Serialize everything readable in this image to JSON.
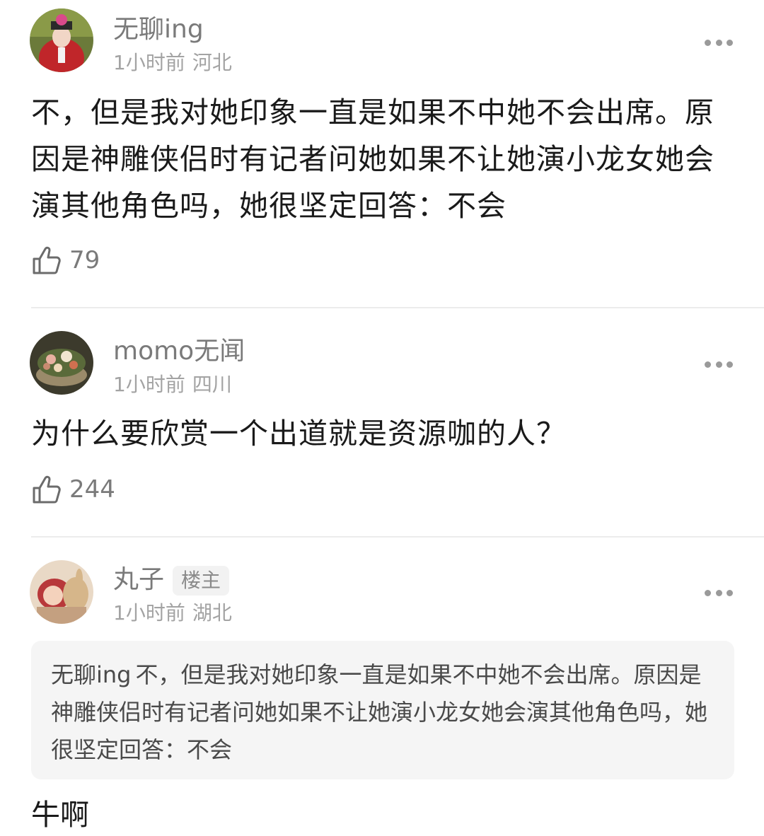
{
  "comments": [
    {
      "username": "无聊ing",
      "time": "1小时前",
      "location": "河北",
      "text": "不，但是我对她印象一直是如果不中她不会出席。原因是神雕侠侣时有记者问她如果不让她演小龙女她会演其他角色吗，她很坚定回答：不会",
      "likes": "79"
    },
    {
      "username": "momo无闻",
      "time": "1小时前",
      "location": "四川",
      "text": "为什么要欣赏一个出道就是资源咖的人？",
      "likes": "244"
    },
    {
      "username": "丸子",
      "badge": "楼主",
      "time": "1小时前",
      "location": "湖北",
      "quote_user": "无聊ing",
      "quote_text": "不，但是我对她印象一直是如果不中她不会出席。原因是神雕侠侣时有记者问她如果不让她演小龙女她会演其他角色吗，她很坚定回答：不会",
      "text": "牛啊"
    }
  ],
  "icons": {
    "like": "thumbs-up-outline-icon",
    "more": "more-dots-icon"
  }
}
